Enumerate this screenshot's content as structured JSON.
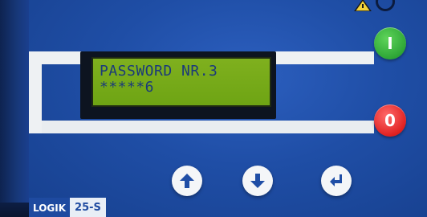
{
  "lcd": {
    "line1": "PASSWORD NR.3",
    "line2": "*****6"
  },
  "buttons": {
    "start_label": "I",
    "stop_label": "0"
  },
  "brand": {
    "name": "LOGIK",
    "model": "25-S"
  },
  "colors": {
    "panel": "#1f4ea6",
    "lcd_background": "#7fb01e",
    "lcd_text": "#1b3a7a",
    "start": "#2ea636",
    "stop": "#e02121"
  },
  "icons": {
    "up": "arrow-up-icon",
    "down": "arrow-down-icon",
    "enter": "enter-return-icon",
    "warning": "warning-triangle-icon"
  }
}
